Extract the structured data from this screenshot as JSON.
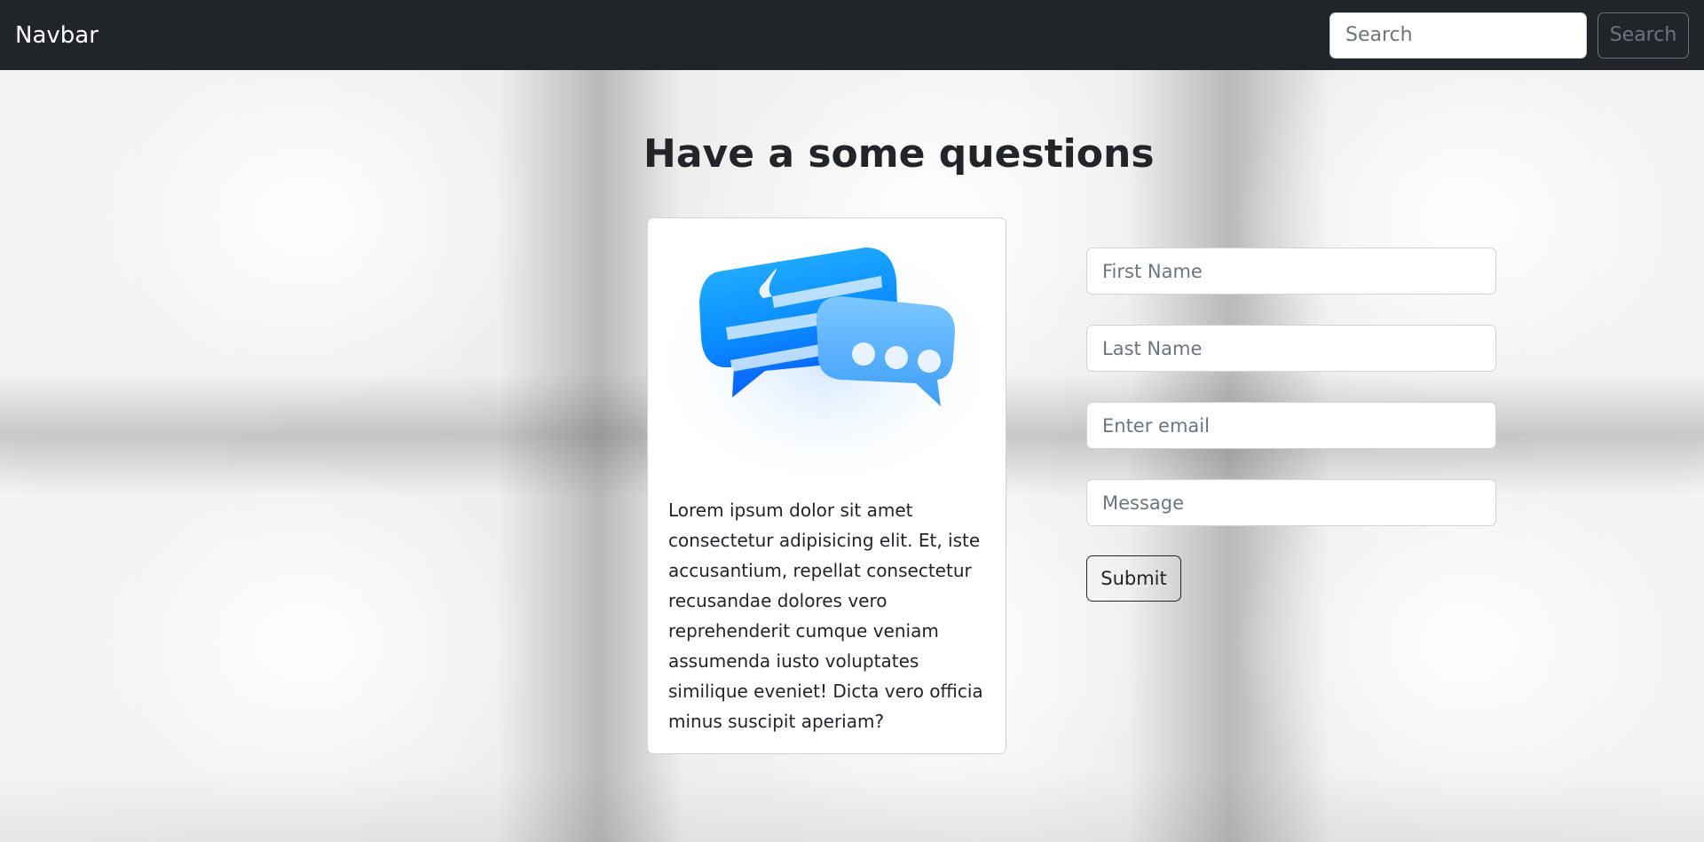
{
  "navbar": {
    "brand": "Navbar",
    "search_placeholder": "Search",
    "search_button": "Search"
  },
  "main": {
    "title": "Have a some questions",
    "card": {
      "image_icon": "chat-bubbles-icon",
      "text": "Lorem ipsum dolor sit amet consectetur adipisicing elit. Et, iste accusantium, repellat consectetur recusandae dolores vero reprehenderit cumque veniam assumenda iusto voluptates similique eveniet! Dicta vero officia minus suscipit aperiam?"
    },
    "form": {
      "first_name_placeholder": "First Name",
      "last_name_placeholder": "Last Name",
      "email_placeholder": "Enter email",
      "message_placeholder": "Message",
      "submit_label": "Submit"
    }
  },
  "colors": {
    "navbar_bg": "#212529",
    "accent_blue": "#1e90ff"
  }
}
